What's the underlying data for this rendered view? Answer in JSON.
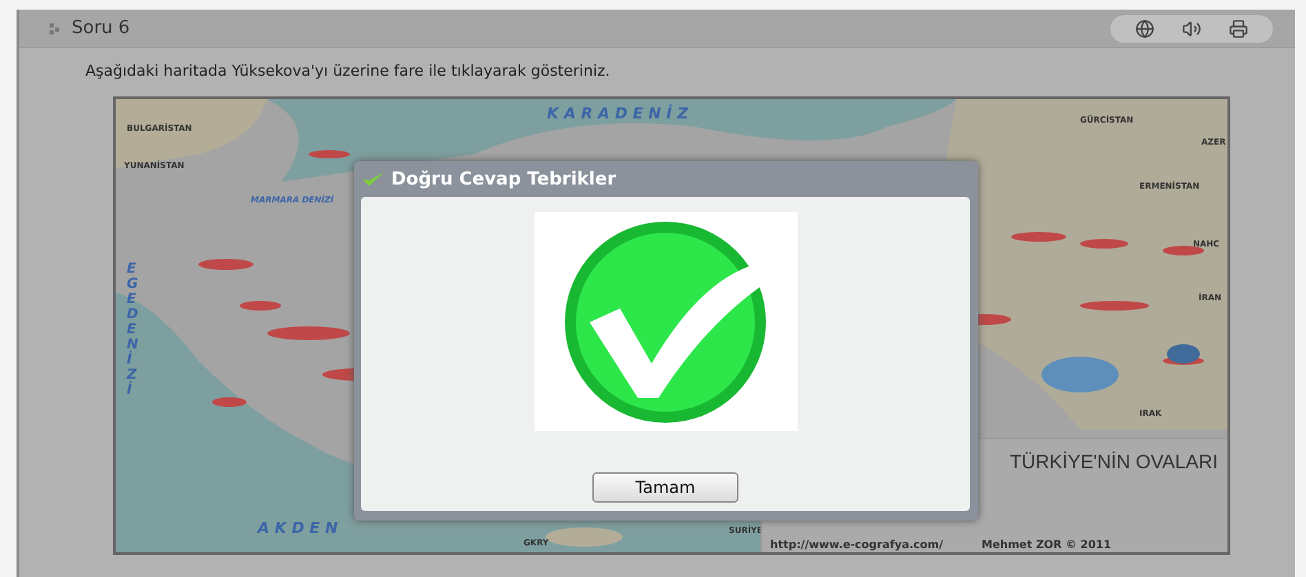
{
  "header": {
    "title": "Soru 6"
  },
  "question": "Aşağıdaki haritada Yüksekova'yı üzerine fare ile tıklayarak gösteriniz.",
  "map": {
    "labels": [
      {
        "kind": "country",
        "text": "BULGARİSTAN"
      },
      {
        "kind": "country",
        "text": "YUNANİSTAN"
      },
      {
        "kind": "sea",
        "text": "MARMARA DENİZİ"
      },
      {
        "kind": "bigsea",
        "text": "K A R A D E N İ Z"
      },
      {
        "kind": "country",
        "text": "GÜRCİSTAN"
      },
      {
        "kind": "country",
        "text": "AZER"
      },
      {
        "kind": "country",
        "text": "ERMENİSTAN"
      },
      {
        "kind": "country",
        "text": "NAHC"
      },
      {
        "kind": "country",
        "text": "İRAN"
      },
      {
        "kind": "country",
        "text": "IRAK"
      },
      {
        "kind": "country",
        "text": "SURİYE"
      },
      {
        "kind": "country",
        "text": "GKRY"
      },
      {
        "kind": "bigsea",
        "text": "A K D E N"
      },
      {
        "kind": "vertical",
        "text": "EGEDENİZİ"
      }
    ],
    "title": "TÜRKİYE'NİN OVALARI",
    "source": "http://www.e-cografya.com/",
    "author": "Mehmet ZOR © 2011"
  },
  "dialog": {
    "title": "Doğru Cevap Tebrikler",
    "button": "Tamam"
  }
}
